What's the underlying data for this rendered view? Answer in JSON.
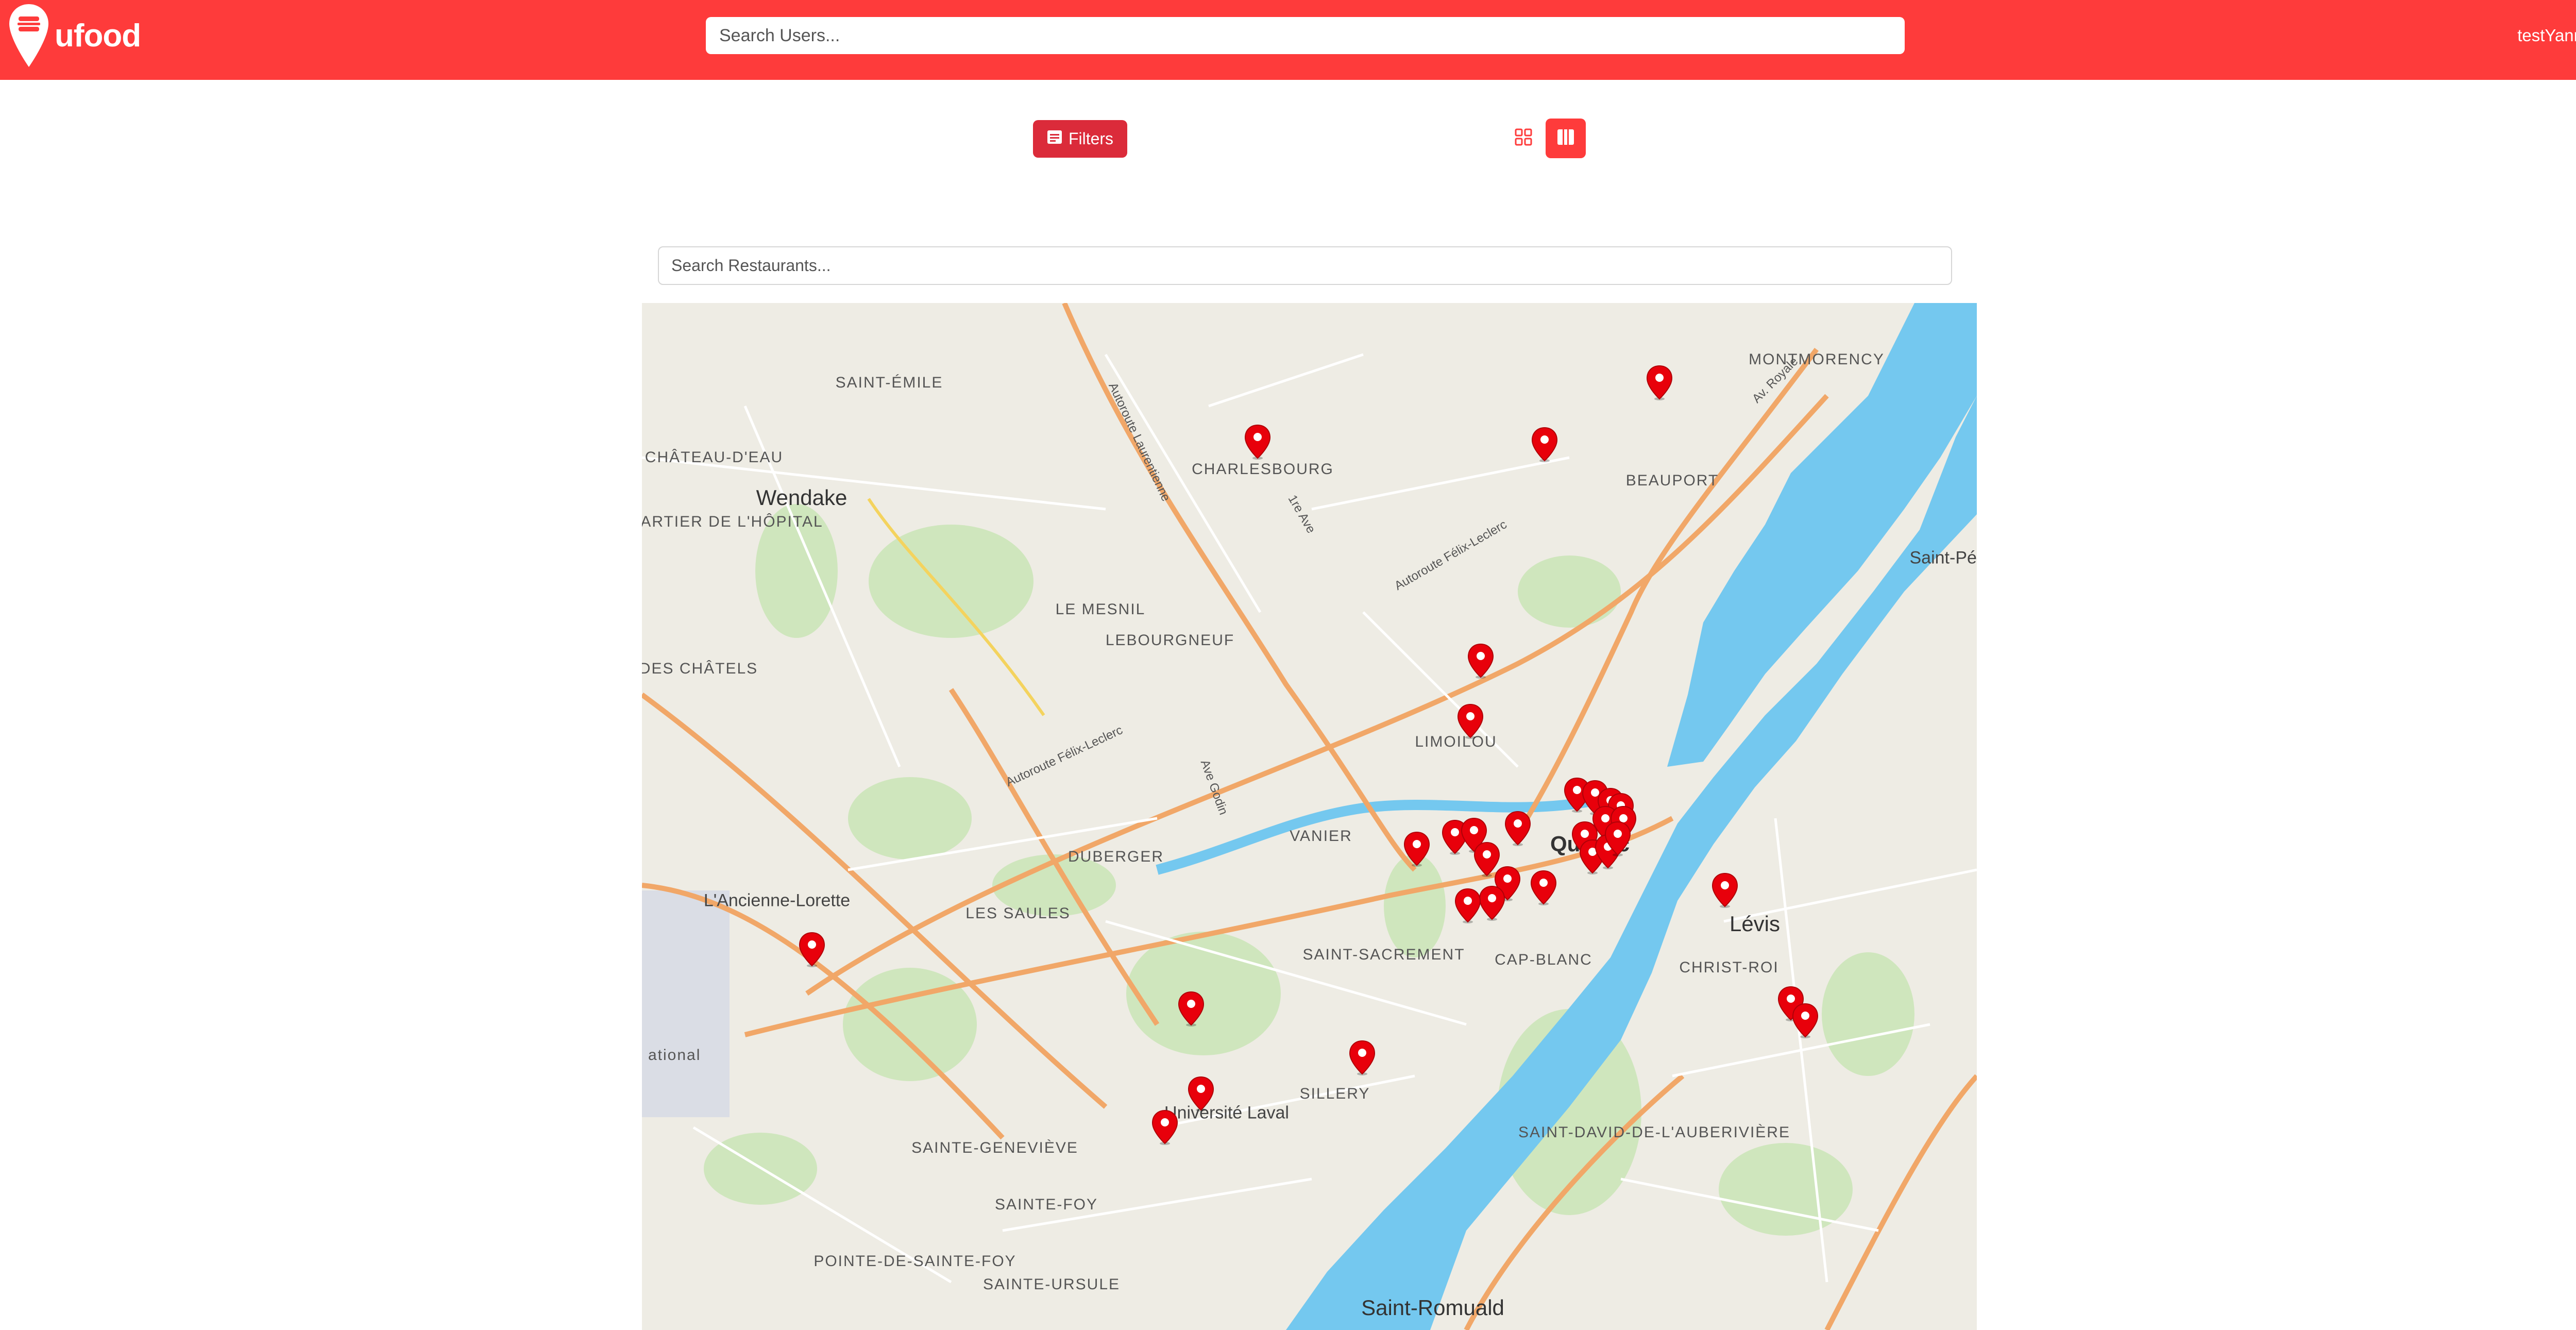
{
  "header": {
    "brand": "ufood",
    "user_search_placeholder": "Search Users...",
    "username": "testYann",
    "accent_color": "#fe3b3b"
  },
  "toolbar": {
    "filters_label": "Filters",
    "view_grid_icon": "grid-icon",
    "view_map_icon": "map-icon"
  },
  "restaurant_search_placeholder": "Search Restaurants...",
  "map": {
    "places": {
      "saint_emile": "SAINT-ÉMILE",
      "chateau_d_eau": "CHÂTEAU-D'EAU",
      "wendake": "Wendake",
      "quartier_hopital": "QUARTIER DE L'HÔPITAL",
      "charlesbourg": "CHARLESBOURG",
      "montmorency": "MONTMORENCY",
      "beauport": "BEAUPORT",
      "saint_petronille": "Saint-Pétron",
      "le_mesnil": "LE MESNIL",
      "lebourgneuf": "LEBOURGNEUF",
      "des_chatels": "DES CHÂTELS",
      "limoilou": "LIMOILOU",
      "vanier": "VANIER",
      "duberger": "DUBERGER",
      "les_saules": "LES SAULES",
      "l_ancienne_lorette": "L'Ancienne-Lorette",
      "quebec": "Québec",
      "levis": "Lévis",
      "saint_sacrement": "SAINT-SACREMENT",
      "cap_blanc": "CAP-BLANC",
      "christ_roi": "CHRIST-ROI",
      "universite_laval": "Université Laval",
      "sillery": "SILLERY",
      "sainte_genevieve": "SAINTE-GENEVIÈVE",
      "sainte_foy": "SAINTE-FOY",
      "pointe_de_sainte_foy": "POINTE-DE-SAINTE-FOY",
      "sainte_ursule": "SAINTE-URSULE",
      "saint_david": "SAINT-DAVID-DE-L'AUBERIVIÈRE",
      "saint_romuald": "Saint-Romuald",
      "airport": "ean ational"
    },
    "road_labels": {
      "autoroute_felix_leclerc": "Autoroute Félix-Leclerc",
      "autoroute_laurentienne": "Autoroute Laurentienne",
      "av_royale": "Av. Royale",
      "premiere_ave": "1re Ave",
      "ave_godin": "Ave Godin"
    },
    "marker_icon": "location-pin-icon",
    "marker_color": "#e8000b",
    "water_color": "#74c8ef"
  }
}
